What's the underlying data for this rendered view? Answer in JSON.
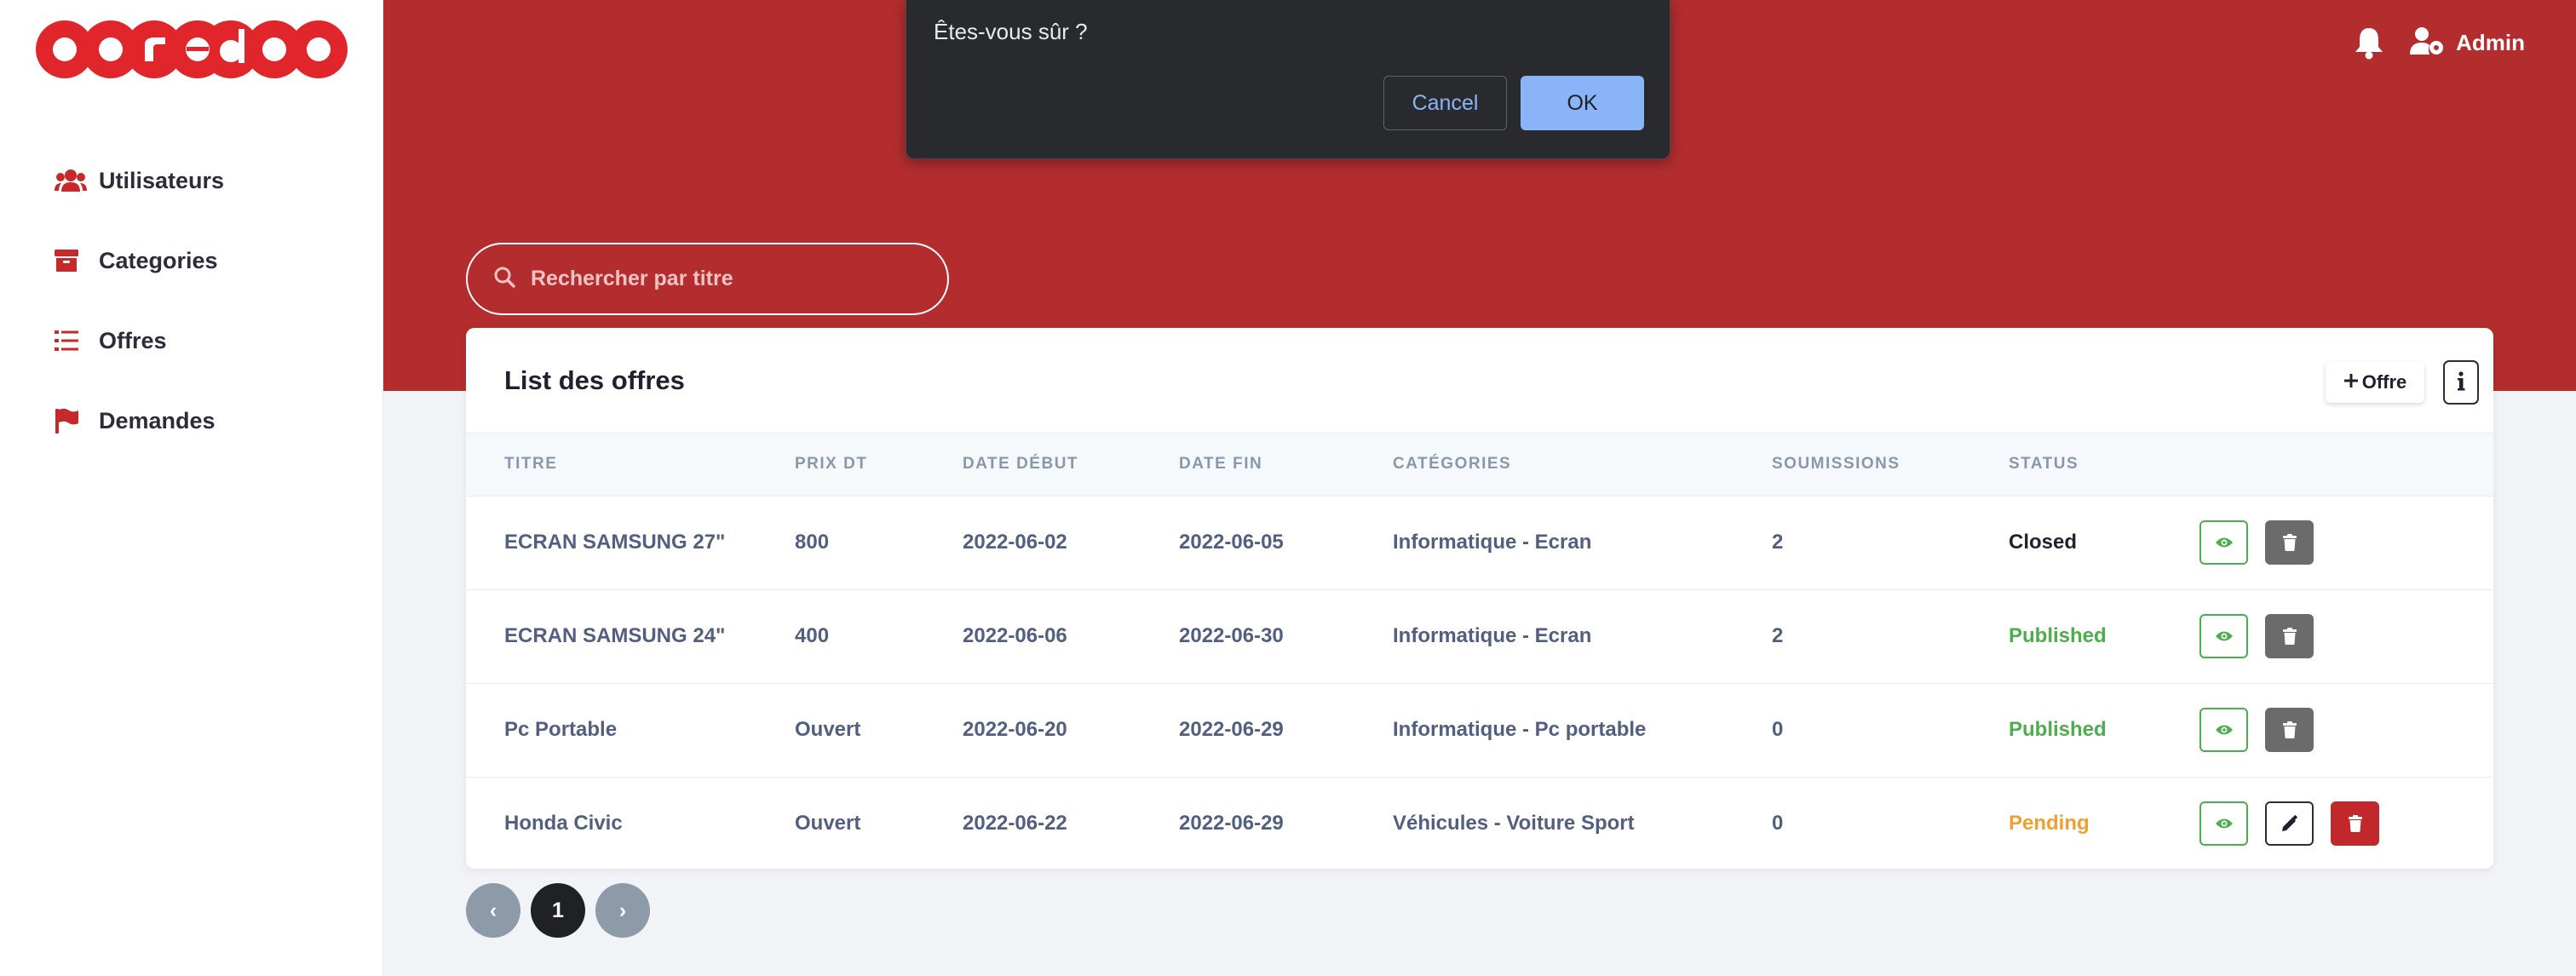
{
  "brand": {
    "logo_text": "ooredoo",
    "red": "#b32d2e"
  },
  "sidebar": {
    "items": [
      {
        "label": "Utilisateurs",
        "icon": "users-icon"
      },
      {
        "label": "Categories",
        "icon": "archive-icon"
      },
      {
        "label": "Offres",
        "icon": "list-icon"
      },
      {
        "label": "Demandes",
        "icon": "flag-icon"
      }
    ]
  },
  "topbar": {
    "notification_icon": "bell-icon",
    "user_icon": "user-cog-icon",
    "user_name": "Admin"
  },
  "search": {
    "placeholder": "Rechercher par titre",
    "value": ""
  },
  "card": {
    "title": "List des offres",
    "add_button_label": "Offre",
    "info_button_icon": "info-icon"
  },
  "table": {
    "headers": [
      "TITRE",
      "PRIX DT",
      "DATE DÉBUT",
      "DATE FIN",
      "CATÉGORIES",
      "SOUMISSIONS",
      "STATUS"
    ],
    "rows": [
      {
        "titre": "ECRAN SAMSUNG 27\"",
        "prix": "800",
        "debut": "2022-06-02",
        "fin": "2022-06-05",
        "categorie": "Informatique - Ecran",
        "soumissions": "2",
        "status": "Closed"
      },
      {
        "titre": "ECRAN SAMSUNG 24\"",
        "prix": "400",
        "debut": "2022-06-06",
        "fin": "2022-06-30",
        "categorie": "Informatique - Ecran",
        "soumissions": "2",
        "status": "Published"
      },
      {
        "titre": "Pc Portable",
        "prix": "Ouvert",
        "debut": "2022-06-20",
        "fin": "2022-06-29",
        "categorie": "Informatique - Pc portable",
        "soumissions": "0",
        "status": "Published"
      },
      {
        "titre": "Honda Civic",
        "prix": "Ouvert",
        "debut": "2022-06-22",
        "fin": "2022-06-29",
        "categorie": "Véhicules - Voiture Sport",
        "soumissions": "0",
        "status": "Pending"
      }
    ]
  },
  "pagination": {
    "prev": "‹",
    "current": "1",
    "next": "›"
  },
  "dialog": {
    "message": "Êtes-vous sûr ?",
    "cancel_label": "Cancel",
    "ok_label": "OK"
  }
}
